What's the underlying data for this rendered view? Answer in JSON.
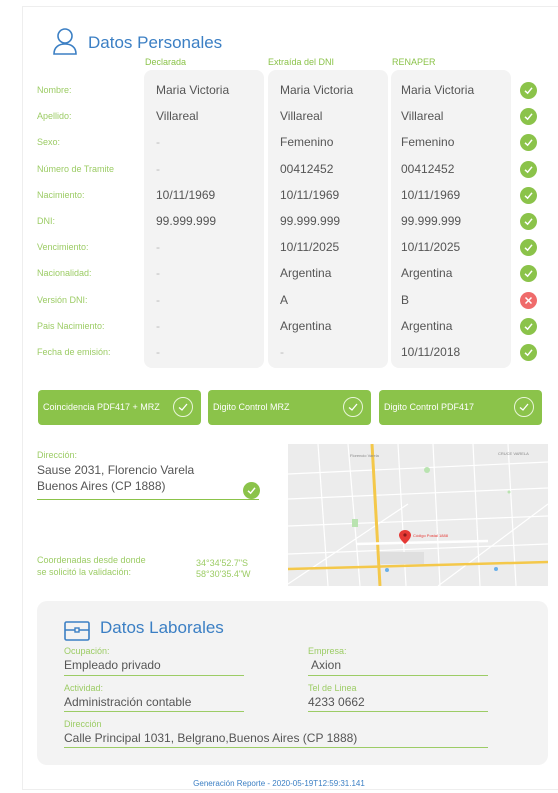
{
  "personal": {
    "title": "Datos Personales",
    "columns": [
      "Declarada",
      "Extraída del DNI",
      "RENAPER"
    ],
    "rows": [
      {
        "label": "Nombre:",
        "declared": "Maria Victoria",
        "dni": "Maria Victoria",
        "renaper": "Maria Victoria",
        "status": "ok"
      },
      {
        "label": "Apellido:",
        "declared": "Villareal",
        "dni": "Villareal",
        "renaper": "Villareal",
        "status": "ok"
      },
      {
        "label": "Sexo:",
        "declared": "-",
        "dni": "Femenino",
        "renaper": "Femenino",
        "status": "ok"
      },
      {
        "label": "Número de Tramite",
        "declared": "-",
        "dni": "00412452",
        "renaper": "00412452",
        "status": "ok"
      },
      {
        "label": "Nacimiento:",
        "declared": "10/11/1969",
        "dni": "10/11/1969",
        "renaper": "10/11/1969",
        "status": "ok"
      },
      {
        "label": "DNI:",
        "declared": "99.999.999",
        "dni": "99.999.999",
        "renaper": "99.999.999",
        "status": "ok"
      },
      {
        "label": "Vencimiento:",
        "declared": "-",
        "dni": "10/11/2025",
        "renaper": "10/11/2025",
        "status": "ok"
      },
      {
        "label": "Nacionalidad:",
        "declared": "-",
        "dni": "Argentina",
        "renaper": "Argentina",
        "status": "ok"
      },
      {
        "label": "Versión DNI:",
        "declared": "-",
        "dni": "A",
        "renaper": "B",
        "status": "fail"
      },
      {
        "label": "Pais Nacimiento:",
        "declared": "-",
        "dni": "Argentina",
        "renaper": "Argentina",
        "status": "ok"
      },
      {
        "label": "Fecha de emisión:",
        "declared": "-",
        "dni": "-",
        "renaper": "10/11/2018",
        "status": "ok"
      }
    ]
  },
  "validations": [
    {
      "label": "Coincidencia PDF417 + MRZ"
    },
    {
      "label": "Digito Control MRZ"
    },
    {
      "label": "Digito Control PDF417"
    }
  ],
  "address": {
    "label": "Dirección:",
    "line1": "Sause 2031, Florencio Varela",
    "line2": "Buenos Aires (CP 1888)"
  },
  "coords": {
    "label1": "Coordenadas desde donde",
    "label2": "se solicitó la validación:",
    "lat": "34°34'52.7\"S",
    "lon": "58°30'35.4\"W"
  },
  "map": {
    "labels": [
      "Florencio Varela",
      "CRUCE VARELA",
      "Código Postal 1888"
    ]
  },
  "laboral": {
    "title": "Datos Laborales",
    "ocupacion_label": "Ocupación:",
    "ocupacion": "Empleado privado",
    "empresa_label": "Empresa:",
    "empresa": "Axion",
    "actividad_label": "Actividad:",
    "actividad": "Administración contable",
    "tel_label": "Tel de Linea",
    "tel": "4233 0662",
    "direccion_label": "Dirección",
    "direccion": "Calle Principal 1031, Belgrano,Buenos Aires (CP 1888)"
  },
  "footer": "Generación Reporte - 2020-05-19T12:59:31.141",
  "colors": {
    "green": "#8bc34a",
    "blue": "#3b7fc4",
    "red": "#ef6b6b"
  }
}
